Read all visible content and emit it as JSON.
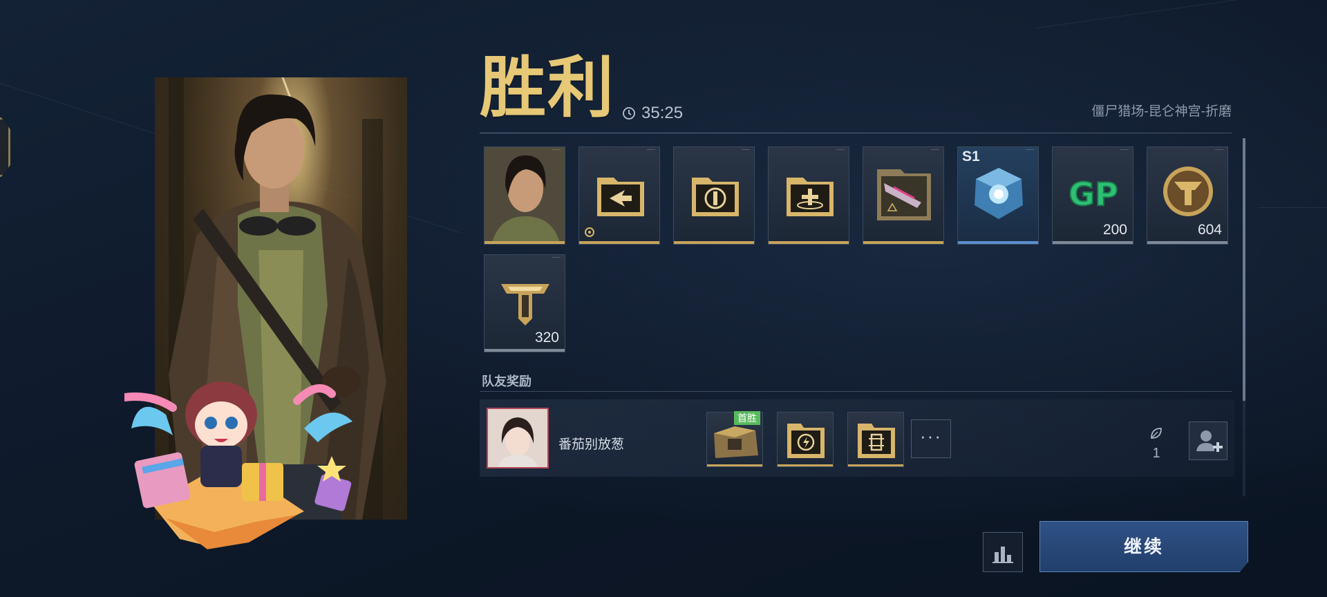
{
  "header": {
    "title": "胜利",
    "timer": "35:25",
    "map_name": "僵尸猎场-昆仑神宫-折磨"
  },
  "rewards": {
    "items": [
      {
        "name": "character-portrait",
        "count": ""
      },
      {
        "name": "blueprint-arrow",
        "count": ""
      },
      {
        "name": "blueprint-grip",
        "count": ""
      },
      {
        "name": "blueprint-scope",
        "count": ""
      },
      {
        "name": "weapon-skin-blueprint",
        "count": ""
      },
      {
        "name": "crystal-cube",
        "grade": "S1",
        "count": ""
      },
      {
        "name": "gp-currency",
        "count": "200"
      },
      {
        "name": "gold-emblem-coin",
        "count": "604"
      },
      {
        "name": "rank-emblem",
        "count": "320"
      }
    ]
  },
  "teammate": {
    "section_label": "队友奖励",
    "name": "番茄别放葱",
    "first_win_badge": "首胜",
    "more_label": "···",
    "like_count": "1"
  },
  "buttons": {
    "continue_label": "继续"
  },
  "colors": {
    "title_gold": "#e6c877",
    "rarity_gold": "#c7a45a",
    "rarity_blue": "#5d8fcf",
    "continue_blue": "#2f5184",
    "first_win_green": "#59b95e"
  }
}
